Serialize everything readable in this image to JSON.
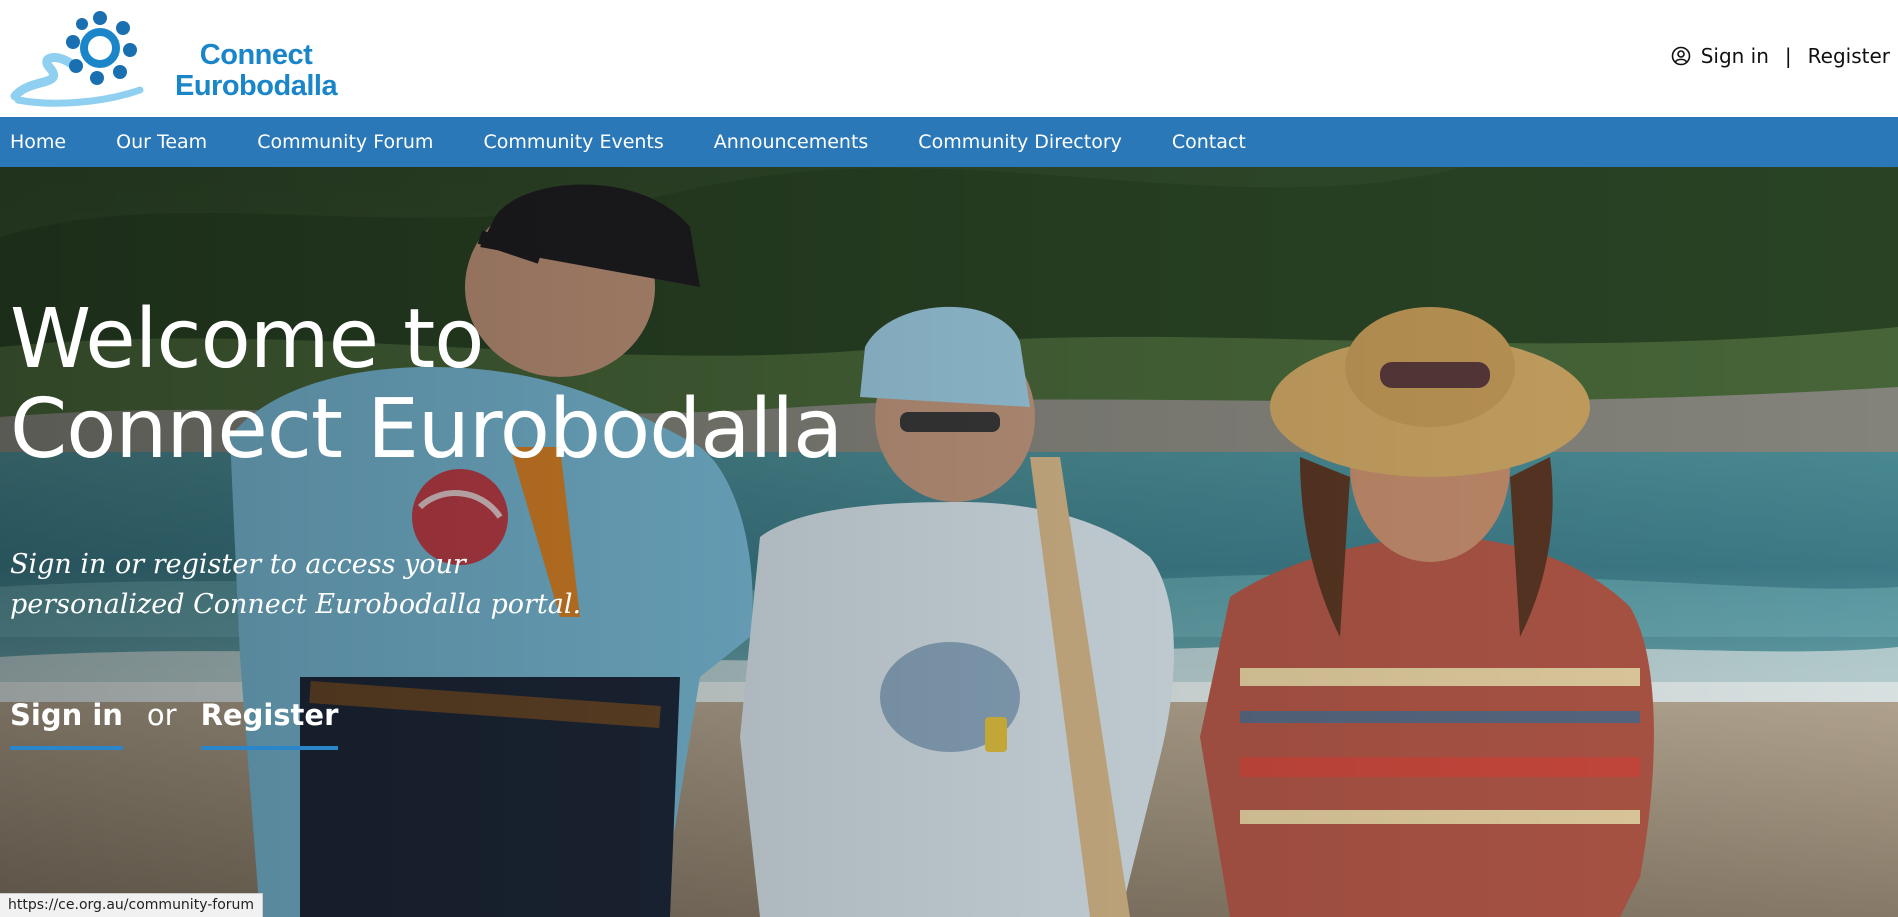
{
  "brand": {
    "line1": "Connect",
    "line2": "Eurobodalla",
    "primary_color": "#1a86c9",
    "accent_color": "#2a78b8"
  },
  "header": {
    "sign_in_label": "Sign in",
    "separator": "|",
    "register_label": "Register",
    "user_icon": "user-circle-icon"
  },
  "nav": {
    "items": [
      {
        "label": "Home"
      },
      {
        "label": "Our Team"
      },
      {
        "label": "Community Forum"
      },
      {
        "label": "Community Events"
      },
      {
        "label": "Announcements"
      },
      {
        "label": "Community Directory"
      },
      {
        "label": "Contact"
      }
    ]
  },
  "hero": {
    "title_line1": "Welcome to",
    "title_line2": "Connect Eurobodalla",
    "subtitle": "Sign in or register to access your personalized Connect Eurobodalla portal.",
    "cta_sign_in": "Sign in",
    "cta_or": "or",
    "cta_register": "Register"
  },
  "status_bar": {
    "url": "https://ce.org.au/community-forum"
  }
}
